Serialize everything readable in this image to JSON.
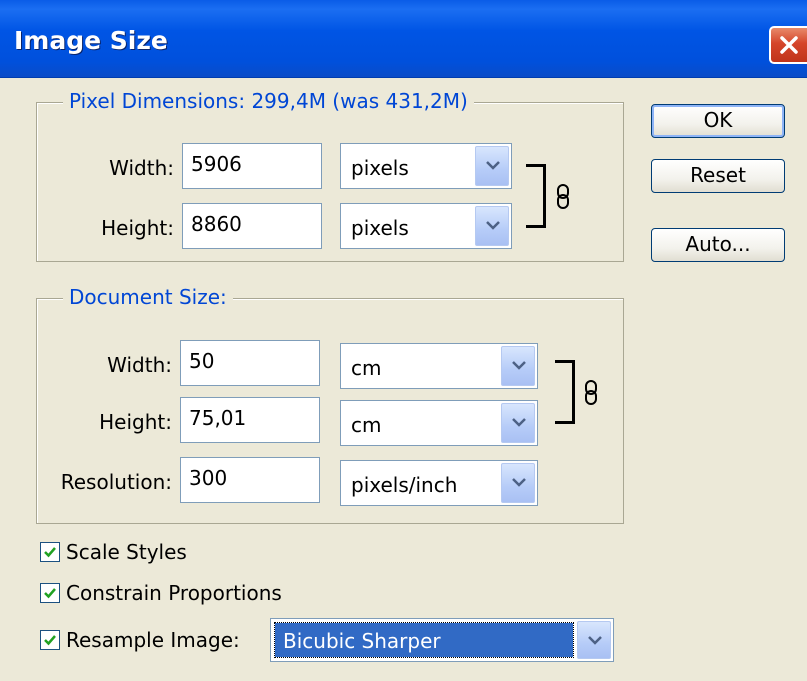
{
  "window": {
    "title": "Image Size"
  },
  "pixel_dimensions": {
    "legend": "Pixel Dimensions:  299,4M (was 431,2M)",
    "width_label": "Width:",
    "width_value": "5906",
    "width_unit": "pixels",
    "height_label": "Height:",
    "height_value": "8860",
    "height_unit": "pixels"
  },
  "document_size": {
    "legend": "Document Size:",
    "width_label": "Width:",
    "width_value": "50",
    "width_unit": "cm",
    "height_label": "Height:",
    "height_value": "75,01",
    "height_unit": "cm",
    "resolution_label": "Resolution:",
    "resolution_value": "300",
    "resolution_unit": "pixels/inch"
  },
  "buttons": {
    "ok": "OK",
    "reset": "Reset",
    "auto": "Auto..."
  },
  "options": {
    "scale_styles": {
      "label": "Scale Styles",
      "checked": true
    },
    "constrain_proportions": {
      "label": "Constrain Proportions",
      "checked": true
    },
    "resample_image": {
      "label": "Resample Image:",
      "checked": true,
      "method": "Bicubic Sharper"
    }
  },
  "colors": {
    "title_bar": "#0054E3",
    "legend_text": "#0046D5",
    "dialog_bg": "#ECE9D8",
    "selection": "#316AC5"
  }
}
